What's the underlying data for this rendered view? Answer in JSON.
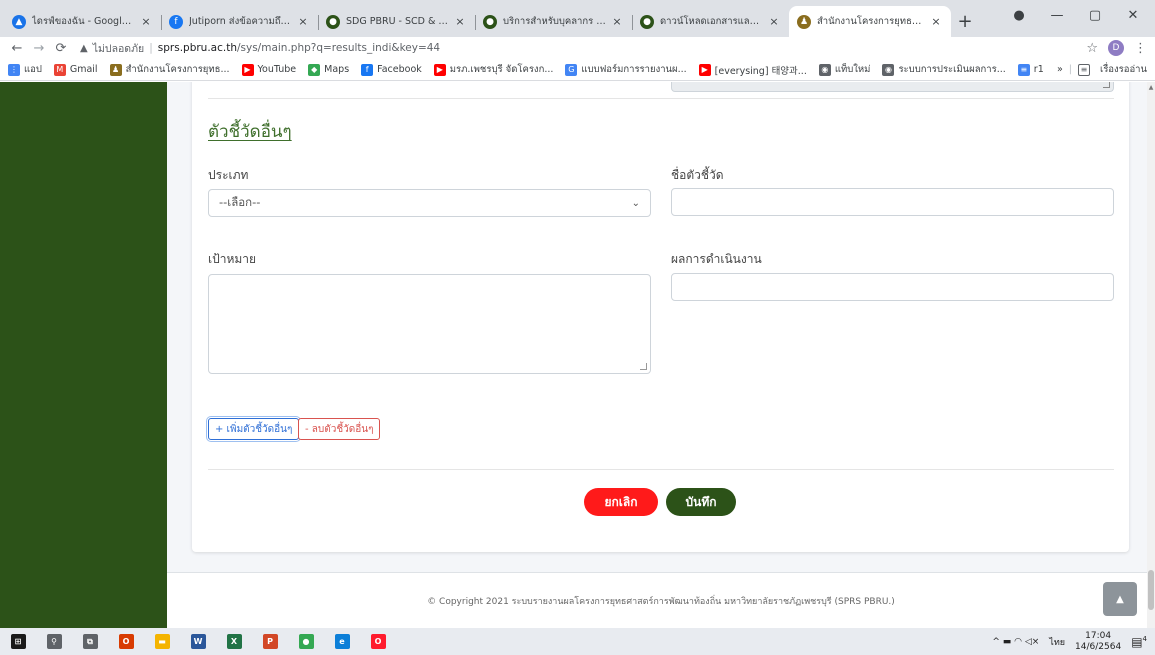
{
  "browser": {
    "tabs": [
      {
        "title": "ไดรฟ์ของฉัน - Google ไดรฟ์",
        "color": "#1a73e8",
        "glyph": "▲"
      },
      {
        "title": "Jutiporn ส่งข้อความถึงคุณ",
        "color": "#1877f2",
        "glyph": "f"
      },
      {
        "title": "SDG PBRU - SCD & SDG PBRU",
        "color": "#2c5218",
        "glyph": "●"
      },
      {
        "title": "บริการสำหรับบุคลากร มหาวิทยา",
        "color": "#2c5218",
        "glyph": "●"
      },
      {
        "title": "ดาวน์โหลดเอกสารและแบบฟอร์ม",
        "color": "#2c5218",
        "glyph": "●"
      },
      {
        "title": "สำนักงานโครงการยุทธศาสตร์การ",
        "color": "#8a6d1e",
        "glyph": "♟",
        "active": true
      }
    ],
    "new_tab": "+",
    "close_glyph": "×",
    "window": {
      "minimize": "—",
      "maximize": "▢",
      "close": "✕",
      "extension": "●"
    },
    "address": {
      "security_label": "ไม่ปลอดภัย",
      "host": "sprs.pbru.ac.th",
      "path": "/sys/main.php?q=results_indi&key=44"
    },
    "profile_initial": "D",
    "bookmarks": [
      {
        "label": "แอป",
        "color": "#4285f4",
        "glyph": "⋮"
      },
      {
        "label": "Gmail",
        "color": "#ea4335",
        "glyph": "M"
      },
      {
        "label": "สำนักงานโครงการยุทธ...",
        "color": "#8a6d1e",
        "glyph": "♟"
      },
      {
        "label": "YouTube",
        "color": "#ff0000",
        "glyph": "▶"
      },
      {
        "label": "Maps",
        "color": "#34a853",
        "glyph": "◆"
      },
      {
        "label": "Facebook",
        "color": "#1877f2",
        "glyph": "f"
      },
      {
        "label": "มรภ.เพชรบุรี จัดโครงก...",
        "color": "#ff0000",
        "glyph": "▶"
      },
      {
        "label": "แบบฟอร์มการรายงานผ...",
        "color": "#4285f4",
        "glyph": "G"
      },
      {
        "label": "[everysing] 태양과...",
        "color": "#ff0000",
        "glyph": "▶"
      },
      {
        "label": "แท็บใหม่",
        "color": "#5f6368",
        "glyph": "◉"
      },
      {
        "label": "ระบบการประเมินผลการ...",
        "color": "#5f6368",
        "glyph": "◉"
      },
      {
        "label": "r1",
        "color": "#4285f4",
        "glyph": "≡"
      }
    ],
    "more_bookmarks": "»",
    "reading_list": "เรื่องรออ่าน"
  },
  "form": {
    "section_title": "ตัวชี้วัดอื่นๆ",
    "type_label": "ประเภท",
    "type_selected": "--เลือก--",
    "indicator_name_label": "ชื่อตัวชี้วัด",
    "target_label": "เป้าหมาย",
    "result_label": "ผลการดำเนินงาน",
    "add_button": "+ เพิ่มตัวชี้วัดอื่นๆ",
    "remove_button": "- ลบตัวชี้วัดอื่นๆ",
    "cancel_button": "ยกเลิก",
    "save_button": "บันทึก"
  },
  "footer": {
    "copyright": "© Copyright 2021 ระบบรายงานผลโครงการยุทธศาสตร์การพัฒนาท้องถิ่น มหาวิทยาลัยราชภัฏเพชรบุรี (SPRS PBRU.)"
  },
  "taskbar": {
    "apps": [
      {
        "name": "start",
        "color": "#1a1a1a",
        "glyph": "⊞"
      },
      {
        "name": "search",
        "color": "#5f6368",
        "glyph": "⚲"
      },
      {
        "name": "task-view",
        "color": "#5f6368",
        "glyph": "⧉"
      },
      {
        "name": "office",
        "color": "#d83b01",
        "glyph": "O"
      },
      {
        "name": "file-explorer",
        "color": "#f4b400",
        "glyph": "▬"
      },
      {
        "name": "word",
        "color": "#2b579a",
        "glyph": "W"
      },
      {
        "name": "excel",
        "color": "#217346",
        "glyph": "X"
      },
      {
        "name": "powerpoint",
        "color": "#d24726",
        "glyph": "P"
      },
      {
        "name": "chrome",
        "color": "#34a853",
        "glyph": "●"
      },
      {
        "name": "edge",
        "color": "#0c7fd8",
        "glyph": "e"
      },
      {
        "name": "opera",
        "color": "#ff1b2d",
        "glyph": "O"
      }
    ],
    "tray_icons": "^  ▬  ◠  ◁×",
    "language": "ไทย",
    "time": "17:04",
    "date": "14/6/2564",
    "notification_count": "4"
  }
}
